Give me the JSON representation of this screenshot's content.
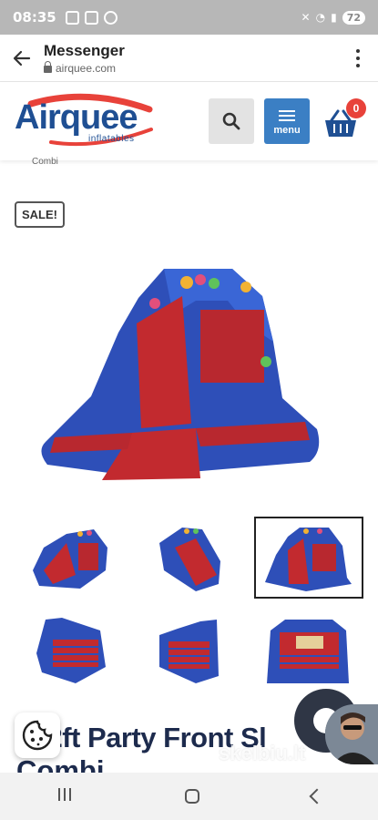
{
  "status_bar": {
    "time": "08:35",
    "battery": "72"
  },
  "browser": {
    "title": "Messenger",
    "url": "airquee.com"
  },
  "site": {
    "logo_text": "Airquee",
    "logo_sub": "inflatables",
    "menu_label": "menu",
    "cart_count": "0",
    "colors": {
      "brand_blue": "#1f4f93",
      "menu_blue": "#3b7fc4",
      "badge_red": "#e8423a"
    }
  },
  "product": {
    "breadcrumb_tail": "Combi",
    "sale_label": "SALE!",
    "title_line1": "x12ft Party Front Sl",
    "title_line2": "Combi"
  },
  "watermark": "skelbiu.lt"
}
